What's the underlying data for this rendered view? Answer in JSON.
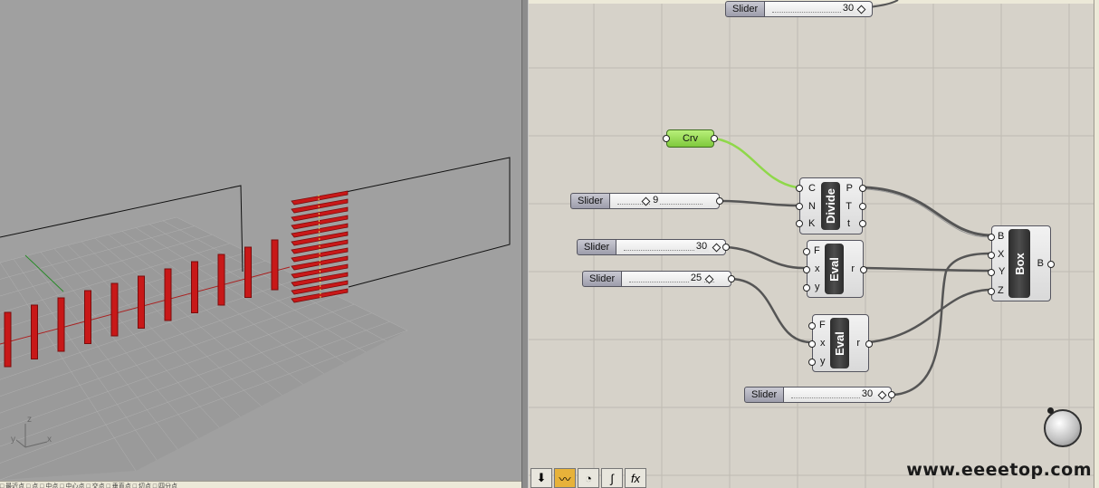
{
  "viewport": {
    "axis_z": "z",
    "axis_y": "y",
    "axis_x": "x",
    "status_text": "□ 最近点 □ 点 □ 中点 □ 中心点 □ 交点 □ 垂直点 □ 切点 □ 四分点"
  },
  "canvas": {
    "top_slider": {
      "label": "Slider",
      "value": "30"
    },
    "crv": {
      "label": "Crv"
    },
    "slider_9": {
      "label": "Slider",
      "value": "9"
    },
    "slider_30a": {
      "label": "Slider",
      "value": "30"
    },
    "slider_25": {
      "label": "Slider",
      "value": "25"
    },
    "slider_30b": {
      "label": "Slider",
      "value": "30"
    },
    "divide": {
      "title": "Divide",
      "inputs": [
        "C",
        "N",
        "K"
      ],
      "outputs": [
        "P",
        "T",
        "t"
      ]
    },
    "eval1": {
      "title": "Eval",
      "inputs": [
        "F",
        "x",
        "y"
      ],
      "outputs": [
        "r"
      ]
    },
    "eval2": {
      "title": "Eval",
      "inputs": [
        "F",
        "x",
        "y"
      ],
      "outputs": [
        "r"
      ]
    },
    "box": {
      "title": "Box",
      "inputs": [
        "B",
        "X",
        "Y",
        "Z"
      ],
      "outputs": [
        "B"
      ]
    }
  },
  "toolbar": {
    "icons": [
      "download-icon",
      "wave-icon",
      "gradient-icon",
      "curve-icon",
      "fx-icon"
    ],
    "fx_label": "fx"
  },
  "watermark": "www.eeeetop.com",
  "colors": {
    "viewport_bg": "#a0a0a0",
    "canvas_bg": "#d6d2c9",
    "fin_red": "#c81818",
    "wire": "#555555",
    "crv_green": "#8fd84a"
  }
}
